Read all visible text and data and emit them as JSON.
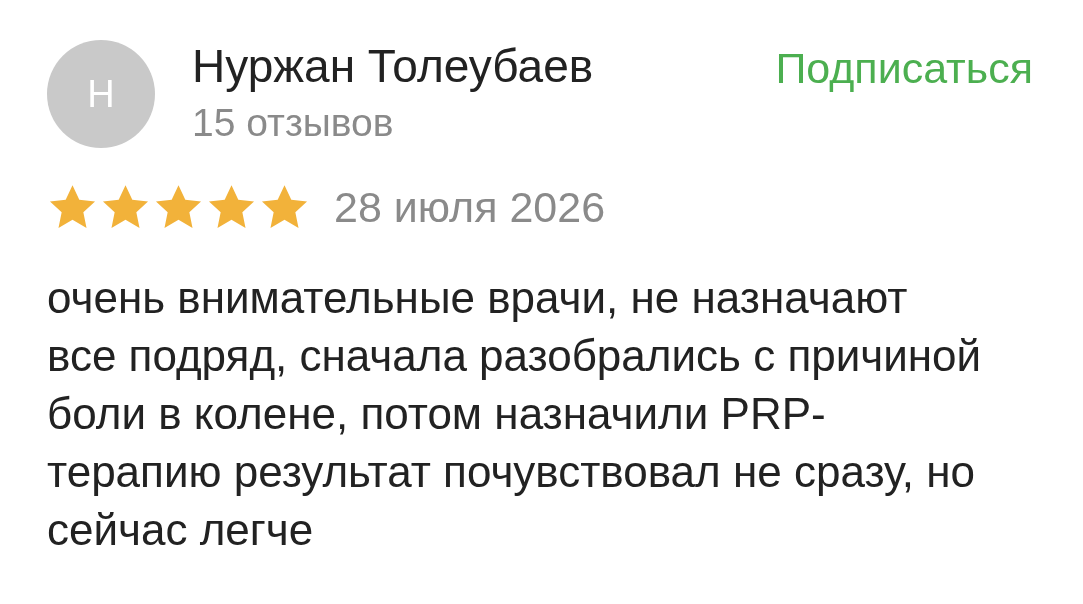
{
  "review": {
    "avatar_letter": "Н",
    "author": "Нуржан Толеубаев",
    "reviews_count": "15 отзывов",
    "subscribe": "Подписаться",
    "stars": 5,
    "date": "28 июля 2026",
    "text": "очень внимательные врачи, не назначают все подряд, сначала разобрались с причиной боли в колене, потом назначили PRP-терапию результат почувствовал не сразу, но сейчас легче"
  }
}
